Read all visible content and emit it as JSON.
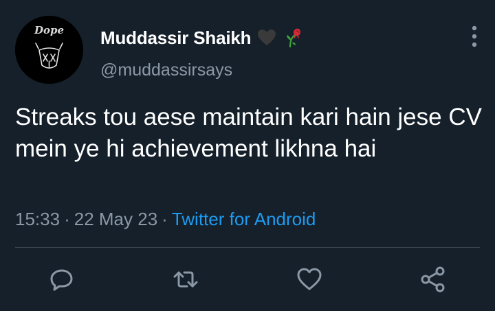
{
  "tweet": {
    "display_name": "Muddassir Shaikh",
    "name_emojis": [
      "black-heart-icon",
      "wilted-rose-icon"
    ],
    "handle": "@muddassirsays",
    "avatar_text": "Dope",
    "text": "Streaks tou aese maintain kari hain jese CV mein ye hi achievement likhna hai",
    "time": "15:33",
    "date": "22 May 23",
    "separator": "·",
    "source": "Twitter for Android"
  },
  "actions": [
    "reply-icon",
    "retweet-icon",
    "like-icon",
    "share-icon"
  ],
  "colors": {
    "background": "#15202b",
    "text": "#ffffff",
    "secondary_text": "#8b98a5",
    "link": "#1d9bf0",
    "divider": "#38444d"
  }
}
